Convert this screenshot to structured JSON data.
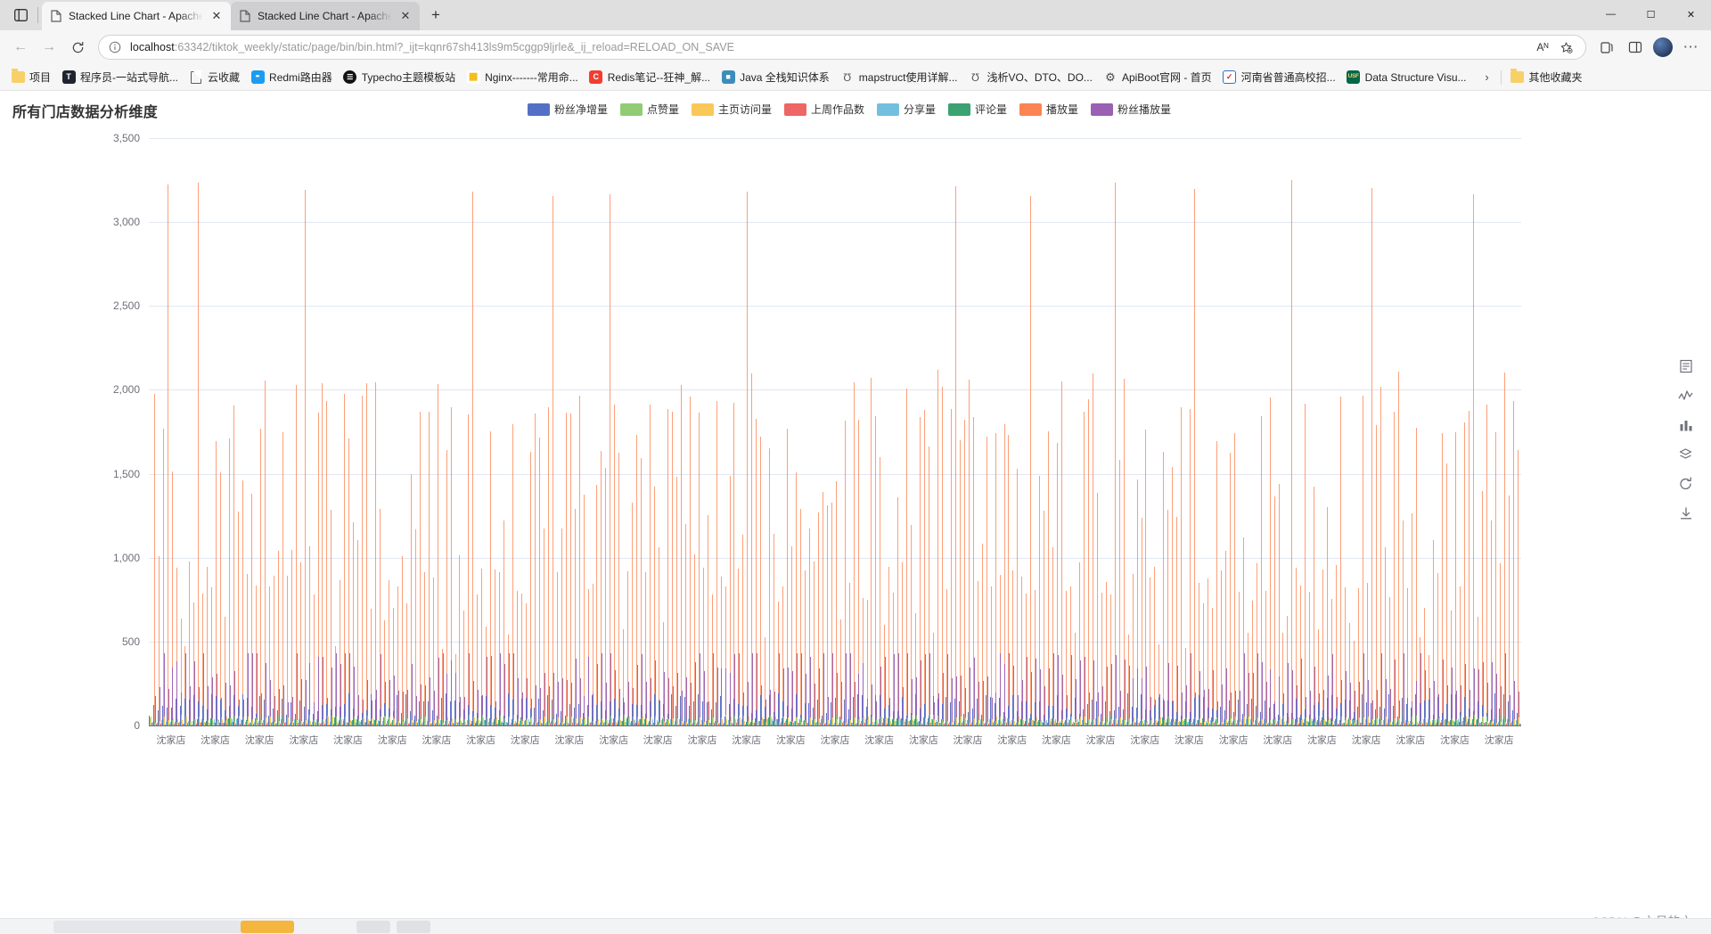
{
  "browser": {
    "tabs": [
      {
        "title": "Stacked Line Chart - Apache ECh",
        "active": true,
        "close": "✕"
      },
      {
        "title": "Stacked Line Chart - Apache ECh",
        "active": false,
        "close": "✕"
      }
    ],
    "new_tab_label": "+",
    "window_controls": {
      "minimize": "—",
      "maximize": "☐",
      "close": "✕"
    },
    "nav": {
      "back": "←",
      "forward": "→",
      "reload": "↻"
    },
    "omnibox": {
      "info_icon": "ⓘ",
      "url_host": "localhost",
      "url_rest": ":63342/tiktok_weekly/static/page/bin/bin.html?_ijt=kqnr67sh413ls9m5cggp9ljrle&_ij_reload=RELOAD_ON_SAVE",
      "read_aloud": "Aᴺ",
      "favorite": "☆"
    },
    "omni_actions": {
      "collections": "⧉",
      "split": "◫",
      "extensions": "⬡",
      "copilot": "◐",
      "settings": "⋯"
    },
    "bookmarks": [
      {
        "label": "项目",
        "icon": "folder-icon",
        "color": "#f7d069"
      },
      {
        "label": "程序员-一站式导航...",
        "icon": "letter-t-icon",
        "color": "#1f2430",
        "glyph": "T"
      },
      {
        "label": "云收藏",
        "icon": "page-icon",
        "color": "#5c5c5c"
      },
      {
        "label": "Redmi路由器",
        "icon": "wifi-icon",
        "color": "#1a9cf0",
        "glyph": "⌑"
      },
      {
        "label": "Typecho主题模板站",
        "icon": "menu-circle-icon",
        "color": "#121212",
        "glyph": "☰"
      },
      {
        "label": "Nginx-------常用命...",
        "icon": "grid-icon",
        "color": "#f0b90b",
        "glyph": "∷"
      },
      {
        "label": "Redis笔记--狂神_解...",
        "icon": "letter-c-icon",
        "color": "#f03e2f",
        "glyph": "C"
      },
      {
        "label": "Java 全栈知识体系",
        "icon": "java-icon",
        "color": "#3c8dbc",
        "glyph": "☕"
      },
      {
        "label": "mapstruct使用详解...",
        "icon": "pen-icon",
        "color": "#555",
        "glyph": "ʃ"
      },
      {
        "label": "浅析VO、DTO、DO...",
        "icon": "pen-icon",
        "color": "#555",
        "glyph": "ʃ"
      },
      {
        "label": "ApiBoot官网 - 首页",
        "icon": "gear-icon",
        "color": "#444",
        "glyph": "⚙"
      },
      {
        "label": "河南省普通高校招...",
        "icon": "checkmark-box-icon",
        "color": "#2f6fc0",
        "glyph": "☑"
      },
      {
        "label": "Data Structure Visu...",
        "icon": "usf-icon",
        "color": "#006747",
        "glyph": "USF"
      }
    ],
    "bookmarks_overflow": "›",
    "other_favorites": {
      "label": "其他收藏夹",
      "icon": "folder-icon"
    }
  },
  "chart_data": {
    "type": "bar",
    "title": "所有门店数据分析维度",
    "xlabel": "",
    "ylabel": "",
    "ylim": [
      0,
      3500
    ],
    "ytick_labels": [
      "3,500",
      "3,000",
      "2,500",
      "2,000",
      "1,500",
      "1,000",
      "500",
      "0"
    ],
    "ytick_values": [
      3500,
      3000,
      2500,
      2000,
      1500,
      1000,
      500,
      0
    ],
    "grid": true,
    "legend_position": "top-center",
    "xtick_label": "沈家店",
    "xtick_count": 31,
    "categories_note": "31 visible 沈家店 store labels along the x axis (dense categorical axis)",
    "series": [
      {
        "name": "粉丝净增量",
        "color": "#5470c6",
        "typical_value": 120,
        "max_value": 260
      },
      {
        "name": "点赞量",
        "color": "#91cc75",
        "typical_value": 40,
        "max_value": 90
      },
      {
        "name": "主页访问量",
        "color": "#fac858",
        "typical_value": 35,
        "max_value": 80
      },
      {
        "name": "上周作品数",
        "color": "#ee6666",
        "typical_value": 10,
        "max_value": 25
      },
      {
        "name": "分享量",
        "color": "#73c0de",
        "typical_value": 25,
        "max_value": 60
      },
      {
        "name": "评论量",
        "color": "#3ba272",
        "typical_value": 30,
        "max_value": 70
      },
      {
        "name": "播放量",
        "color": "#fc8452",
        "typical_value": 950,
        "max_value": 3250
      },
      {
        "name": "粉丝播放量",
        "color": "#9a60b4",
        "typical_value": 300,
        "max_value": 430
      }
    ]
  },
  "toolbox": {
    "items": [
      {
        "name": "data-view-icon",
        "glyph": "☰"
      },
      {
        "name": "line-chart-icon",
        "glyph": "〰"
      },
      {
        "name": "bar-chart-icon",
        "glyph": "☰"
      },
      {
        "name": "stack-icon",
        "glyph": "⬡"
      },
      {
        "name": "restore-icon",
        "glyph": "↺"
      },
      {
        "name": "save-image-icon",
        "glyph": "↓"
      }
    ]
  },
  "watermark": {
    "text": "CSDN @六月的六·"
  },
  "taskbar": {
    "clock": ""
  }
}
